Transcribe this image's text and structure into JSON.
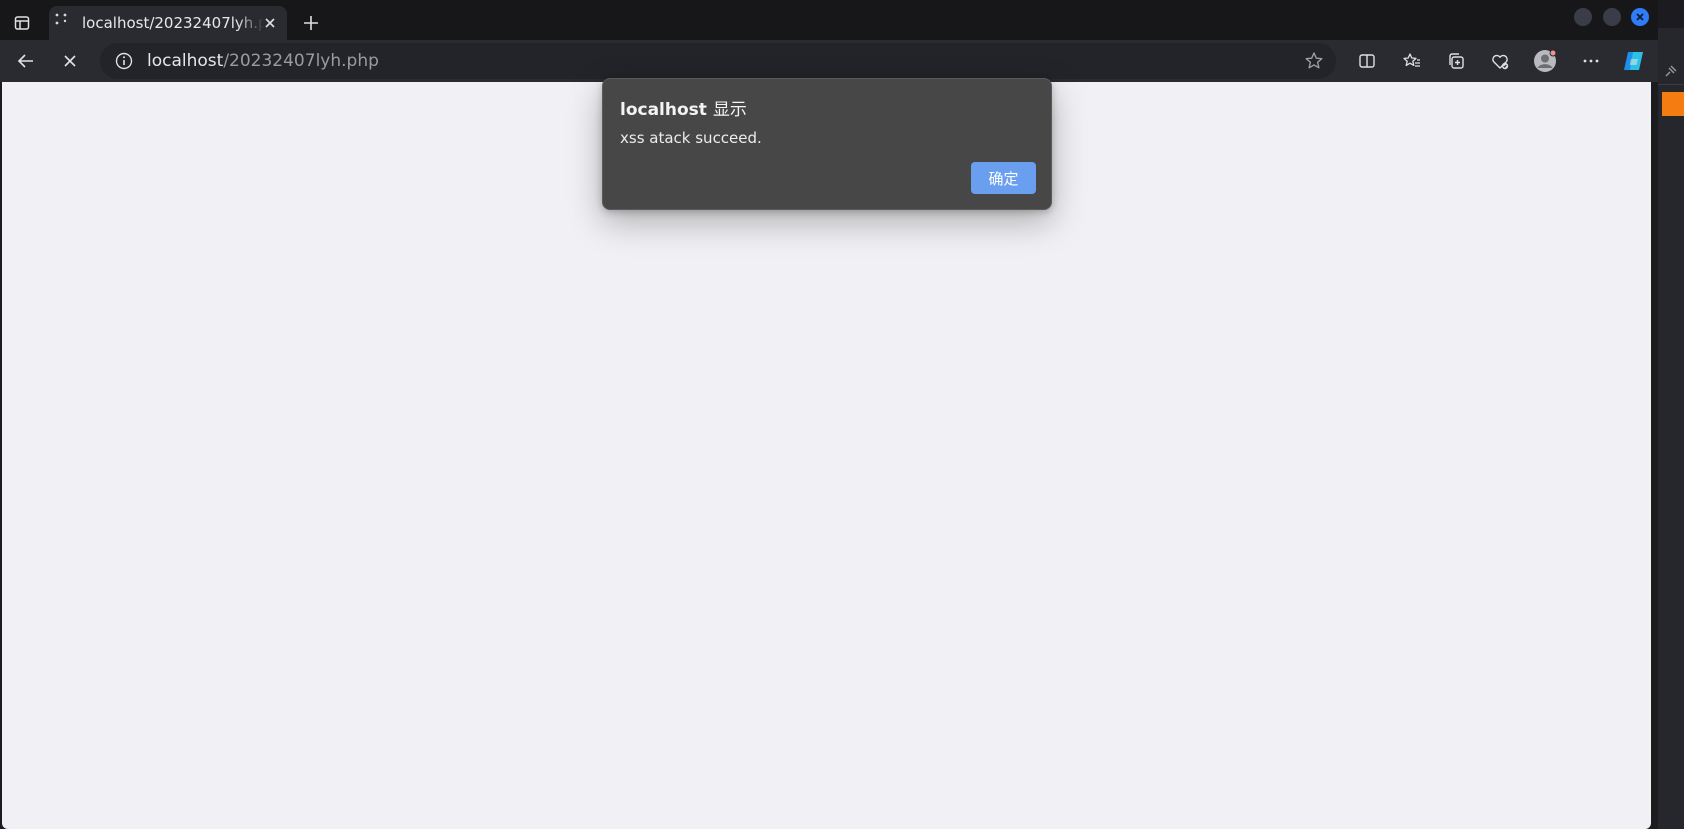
{
  "browser": {
    "tab": {
      "title": "localhost/20232407lyh.php",
      "close_label": "×"
    },
    "new_tab_label": "+",
    "address": {
      "host": "localhost",
      "path": "/20232407lyh.php"
    }
  },
  "dialog": {
    "title": "localhost",
    "title_suffix": "显示",
    "message": "xss atack succeed.",
    "ok_label": "确定"
  },
  "colors": {
    "page_background": "#f1f1f5",
    "dialog_background": "#474747",
    "ok_button": "#6a9fef",
    "window_close": "#2f7cf6",
    "side_accent": "#f47c10"
  },
  "icons": [
    "tab-actions-icon",
    "loading-favicon-icon",
    "close-icon",
    "plus-icon",
    "back-arrow-icon",
    "stop-loading-icon",
    "info-icon",
    "star-icon",
    "split-screen-icon",
    "favorites-icon",
    "collections-icon",
    "browser-essentials-icon",
    "profile-avatar-icon",
    "more-icon",
    "copilot-icon",
    "pin-icon"
  ]
}
